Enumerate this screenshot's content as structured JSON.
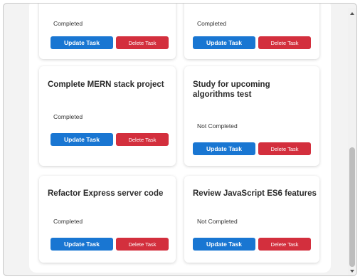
{
  "tasks": [
    {
      "title": "",
      "status": "Completed",
      "update_label": "Update Task",
      "delete_label": "Delete Task"
    },
    {
      "title": "",
      "status": "Completed",
      "update_label": "Update Task",
      "delete_label": "Delete Task"
    },
    {
      "title": "Complete MERN stack project",
      "status": "Completed",
      "update_label": "Update Task",
      "delete_label": "Delete Task"
    },
    {
      "title": "Study for upcoming algorithms test",
      "status": "Not Completed",
      "update_label": "Update Task",
      "delete_label": "Delete Task"
    },
    {
      "title": "Refactor Express server code",
      "status": "Completed",
      "update_label": "Update Task",
      "delete_label": "Delete Task"
    },
    {
      "title": "Review JavaScript ES6 features",
      "status": "Not Completed",
      "update_label": "Update Task",
      "delete_label": "Delete Task"
    }
  ],
  "colors": {
    "update_button": "#1976d2",
    "delete_button": "#d32f3d"
  }
}
